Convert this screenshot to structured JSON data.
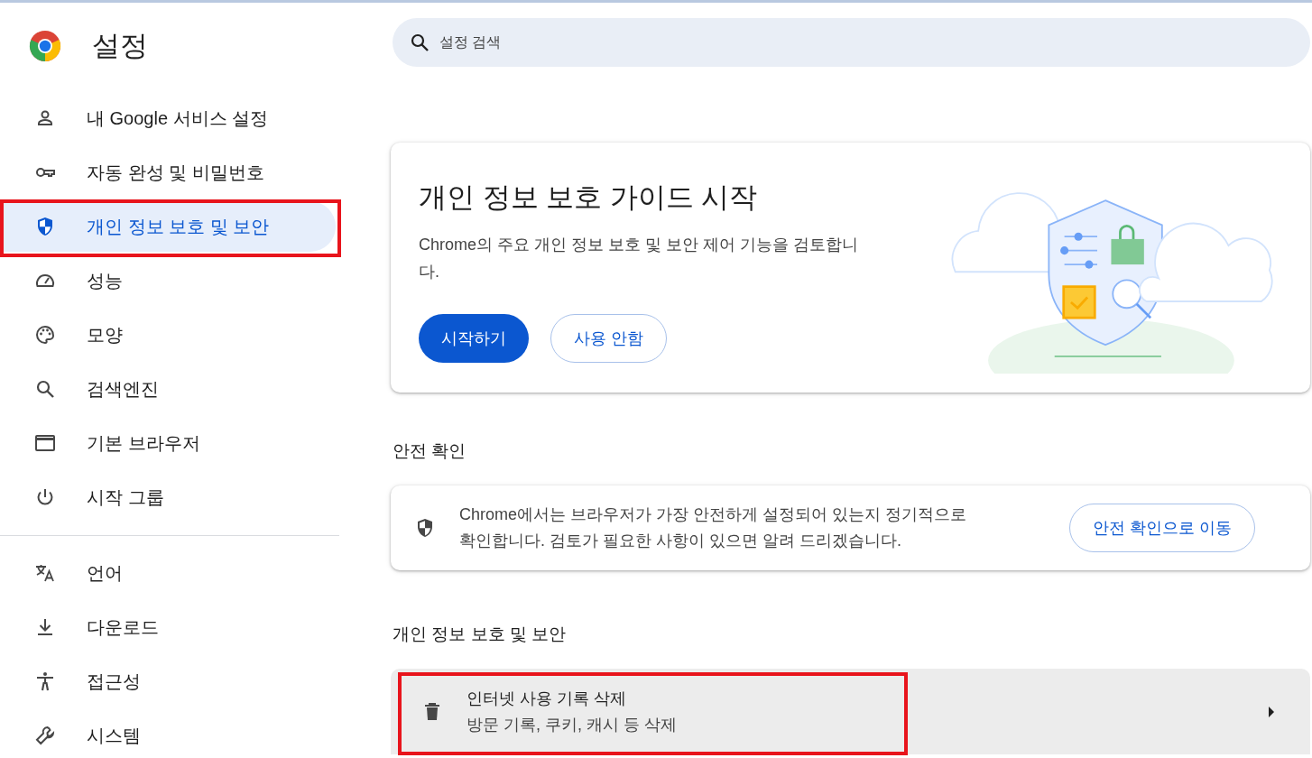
{
  "header": {
    "title": "설정",
    "search": {
      "placeholder": "설정 검색"
    }
  },
  "sidebar": {
    "groups": [
      {
        "items": [
          {
            "label": "내 Google 서비스 설정",
            "kind": "person",
            "selected": false,
            "highlighted": false
          },
          {
            "label": "자동 완성 및 비밀번호",
            "kind": "key",
            "selected": false,
            "highlighted": false
          },
          {
            "label": "개인 정보 보호 및 보안",
            "kind": "shield",
            "selected": true,
            "highlighted": true
          },
          {
            "label": "성능",
            "kind": "gauge",
            "selected": false,
            "highlighted": false
          },
          {
            "label": "모양",
            "kind": "palette",
            "selected": false,
            "highlighted": false
          },
          {
            "label": "검색엔진",
            "kind": "search",
            "selected": false,
            "highlighted": false
          },
          {
            "label": "기본 브라우저",
            "kind": "window",
            "selected": false,
            "highlighted": false
          },
          {
            "label": "시작 그룹",
            "kind": "power",
            "selected": false,
            "highlighted": false
          }
        ]
      },
      {
        "items": [
          {
            "label": "언어",
            "kind": "translate",
            "selected": false,
            "highlighted": false
          },
          {
            "label": "다운로드",
            "kind": "download",
            "selected": false,
            "highlighted": false
          },
          {
            "label": "접근성",
            "kind": "accessibility",
            "selected": false,
            "highlighted": false
          },
          {
            "label": "시스템",
            "kind": "wrench",
            "selected": false,
            "highlighted": false
          }
        ]
      }
    ]
  },
  "guide_card": {
    "title": "개인 정보 보호 가이드 시작",
    "description": "Chrome의 주요 개인 정보 보호 및 보안 제어 기능을 검토합니다.",
    "primary_button": "시작하기",
    "secondary_button": "사용 안함"
  },
  "safety_check": {
    "heading": "안전 확인",
    "text": "Chrome에서는 브라우저가 가장 안전하게 설정되어 있는지 정기적으로 확인합니다. 검토가 필요한 사항이 있으면 알려 드리겠습니다.",
    "button": "안전 확인으로 이동"
  },
  "privacy_section": {
    "heading": "개인 정보 보호 및 보안",
    "rows": [
      {
        "title": "인터넷 사용 기록 삭제",
        "subtitle": "방문 기록, 쿠키, 캐시 등 삭제",
        "kind": "trash",
        "highlighted": true
      }
    ]
  }
}
